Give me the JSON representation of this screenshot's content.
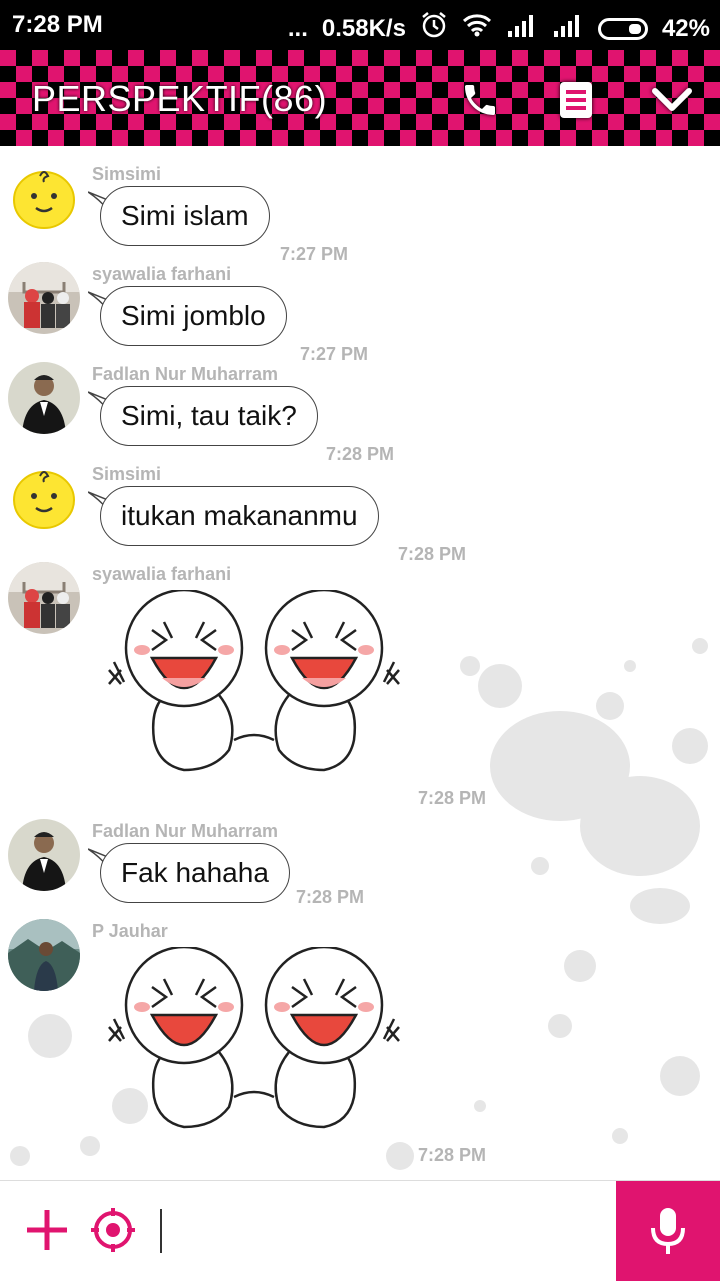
{
  "status_bar": {
    "time": "7:28 PM",
    "dots": "...",
    "speed": "0.58K/s",
    "battery": "42%",
    "icons": [
      "alarm-icon",
      "wifi-icon",
      "signal-icon",
      "signal-icon",
      "battery-icon"
    ]
  },
  "header": {
    "title": "PERSPEKTIF(86)",
    "icons": [
      "phone-icon",
      "notes-icon",
      "chevron-down-icon"
    ]
  },
  "colors": {
    "accent": "#e0146f",
    "header_checker": "#000000",
    "muted_text": "#b5b5b5"
  },
  "messages": [
    {
      "sender": "Simsimi",
      "text": "Simi islam",
      "time": "7:27 PM"
    },
    {
      "sender": "syawalia farhani",
      "text": "Simi jomblo",
      "time": "7:27 PM"
    },
    {
      "sender": "Fadlan Nur Muharram",
      "text": "Simi, tau taik?",
      "time": "7:28 PM"
    },
    {
      "sender": "Simsimi",
      "text": "itukan makananmu",
      "time": "7:28 PM"
    },
    {
      "sender": "syawalia farhani",
      "sticker": "laughing-sticker",
      "time": "7:28 PM"
    },
    {
      "sender": "Fadlan Nur Muharram",
      "text": "Fak hahaha",
      "time": "7:28 PM"
    },
    {
      "sender": "P Jauhar",
      "sticker": "laughing-sticker",
      "time": "7:28 PM"
    }
  ],
  "input": {
    "icons": [
      "plus-icon",
      "target-icon",
      "microphone-icon"
    ]
  }
}
